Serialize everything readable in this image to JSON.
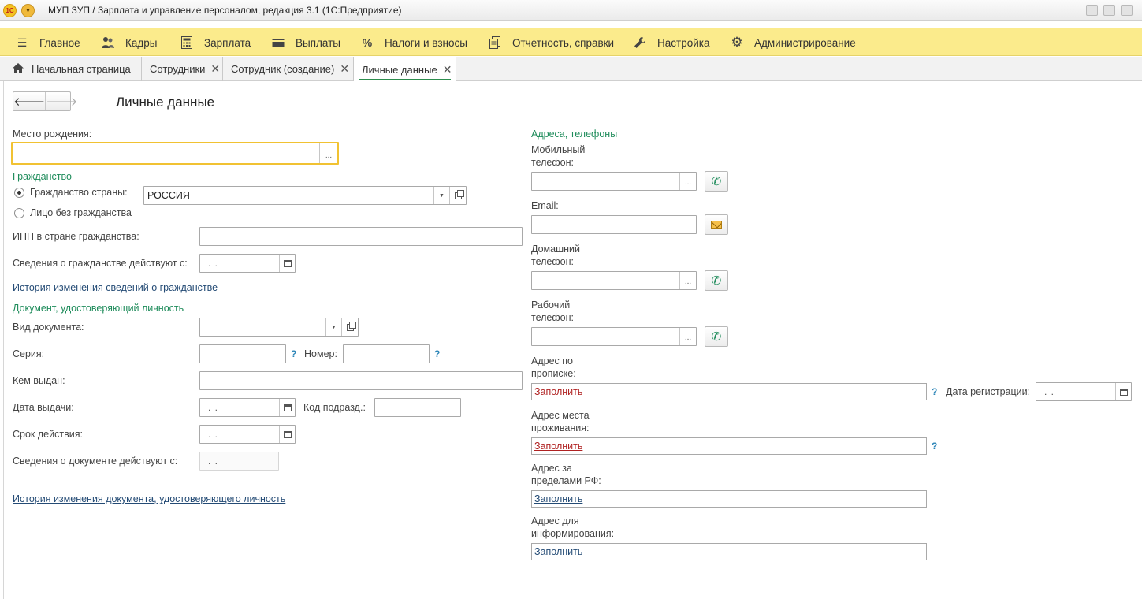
{
  "window": {
    "title": "МУП ЗУП / Зарплата и управление персоналом, редакция 3.1  (1С:Предприятие)",
    "logo_text": "1С"
  },
  "main_menu": [
    {
      "label": "Главное",
      "icon": "hamburger-icon"
    },
    {
      "label": "Кадры",
      "icon": "users-icon"
    },
    {
      "label": "Зарплата",
      "icon": "calculator-icon"
    },
    {
      "label": "Выплаты",
      "icon": "wallet-icon"
    },
    {
      "label": "Налоги и взносы",
      "icon": "percent-icon"
    },
    {
      "label": "Отчетность, справки",
      "icon": "reports-icon"
    },
    {
      "label": "Настройка",
      "icon": "wrench-icon"
    },
    {
      "label": "Администрирование",
      "icon": "gear-icon"
    }
  ],
  "tabs": [
    {
      "label": "Начальная страница",
      "icon": "home-icon",
      "closable": false
    },
    {
      "label": "Сотрудники",
      "closable": true
    },
    {
      "label": "Сотрудник (создание)",
      "closable": true
    },
    {
      "label": "Личные данные",
      "closable": true,
      "active": true
    }
  ],
  "form": {
    "title": "Личные данные",
    "birthplace": {
      "label": "Место рождения:",
      "value": ""
    },
    "citizenship": {
      "group_title": "Гражданство",
      "radio_country": "Гражданство страны:",
      "country_value": "РОССИЯ",
      "radio_stateless": "Лицо без гражданства",
      "inn_label": "ИНН в стране гражданства:",
      "inn_value": "",
      "valid_from_label": "Сведения о гражданстве действуют с:",
      "valid_from_value": ". .",
      "history_link": "История изменения сведений о гражданстве"
    },
    "identity": {
      "group_title": "Документ, удостоверяющий личность",
      "doc_type_label": "Вид документа:",
      "doc_type_value": "",
      "series_label": "Серия:",
      "series_value": "",
      "number_label": "Номер:",
      "number_value": "",
      "issued_by_label": "Кем выдан:",
      "issued_by_value": "",
      "issue_date_label": "Дата выдачи:",
      "issue_date_value": ". .",
      "division_code_label": "Код подразд.:",
      "division_code_value": "",
      "expiry_label": "Срок действия:",
      "expiry_value": ". .",
      "valid_from_label": "Сведения о документе действуют с:",
      "valid_from_value": ". .",
      "history_link": "История изменения документа, удостоверяющего личность"
    },
    "contacts": {
      "group_title": "Адреса, телефоны",
      "mobile_label_1": "Мобильный",
      "mobile_label_2": "телефон:",
      "email_label": "Email:",
      "home_label_1": "Домашний",
      "home_label_2": "телефон:",
      "work_label_1": "Рабочий",
      "work_label_2": "телефон:",
      "reg_address_label_1": "Адрес по",
      "reg_address_label_2": "прописке:",
      "reg_address_link": "Заполнить",
      "reg_date_label": "Дата регистрации:",
      "reg_date_value": ". .",
      "living_address_label_1": "Адрес места",
      "living_address_label_2": "проживания:",
      "living_address_link": "Заполнить",
      "foreign_address_label_1": "Адрес за",
      "foreign_address_label_2": "пределами РФ:",
      "foreign_address_link": "Заполнить",
      "info_address_label_1": "Адрес для",
      "info_address_label_2": "информирования:",
      "info_address_link": "Заполнить"
    },
    "help_glyph": "?",
    "ellipsis_glyph": "...",
    "close_glyph": "✕"
  },
  "colors": {
    "menu_bg": "#fbeb8c",
    "group_title": "#1f8c5b",
    "link": "#244b75",
    "link_red": "#b02222",
    "focus_border": "#f1c232"
  }
}
